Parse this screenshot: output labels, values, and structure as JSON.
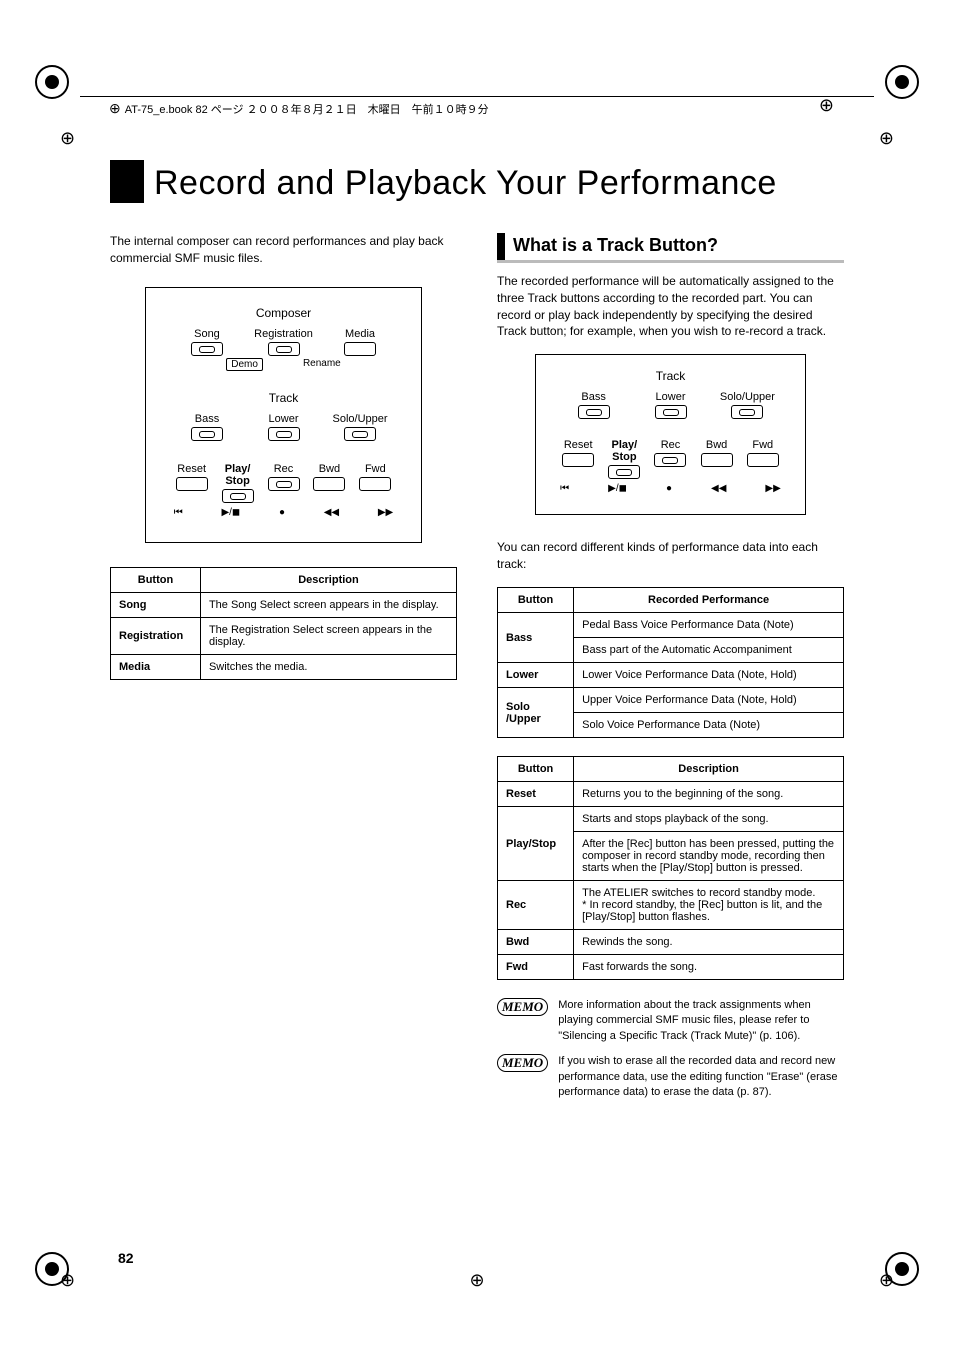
{
  "header_label": "AT-75_e.book 82 ページ ２００８年８月２１日　木曜日　午前１０時９分",
  "page_number": "82",
  "title": "Record and Playback Your Performance",
  "intro": "The internal composer can record performances and play back commercial SMF music files.",
  "composer_panel": {
    "title": "Composer",
    "row1": [
      "Song",
      "Registration",
      "Media"
    ],
    "connectors": [
      "Demo",
      "Rename"
    ],
    "track_title": "Track",
    "row2": [
      "Bass",
      "Lower",
      "Solo/Upper"
    ],
    "row3": [
      "Reset",
      "Play/\nStop",
      "Rec",
      "Bwd",
      "Fwd"
    ],
    "symbols": [
      "⏮",
      "▶/◼",
      "●",
      "◀◀",
      "▶▶"
    ]
  },
  "table1": {
    "headers": [
      "Button",
      "Description"
    ],
    "rows": [
      {
        "k": "Song",
        "v": "The Song Select screen appears in the display."
      },
      {
        "k": "Registration",
        "v": "The Registration Select screen appears in the display."
      },
      {
        "k": "Media",
        "v": "Switches the media."
      }
    ]
  },
  "section_title": "What is a Track Button?",
  "section_intro": "The recorded performance will be automatically assigned to the three Track buttons according to the recorded part. You can record or play back independently by specifying the desired Track button; for example, when you wish to re-record a track.",
  "track_panel": {
    "title": "Track",
    "row1": [
      "Bass",
      "Lower",
      "Solo/Upper"
    ],
    "row2": [
      "Reset",
      "Play/\nStop",
      "Rec",
      "Bwd",
      "Fwd"
    ],
    "symbols": [
      "⏮",
      "▶/◼",
      "●",
      "◀◀",
      "▶▶"
    ]
  },
  "track_note": "You can record different kinds of performance data into each track:",
  "table2": {
    "headers": [
      "Button",
      "Recorded Performance"
    ],
    "rows": [
      {
        "k": "Bass",
        "v": "Pedal Bass Voice Performance Data (Note)",
        "rowspan": 2
      },
      {
        "v2": "Bass part of the Automatic Accompaniment"
      },
      {
        "k": "Lower",
        "v": "Lower Voice Performance Data (Note, Hold)"
      },
      {
        "k": "Solo\n/Upper",
        "v": "Upper Voice Performance Data (Note, Hold)",
        "rowspan": 2
      },
      {
        "v2": "Solo Voice Performance Data (Note)"
      }
    ]
  },
  "table3": {
    "headers": [
      "Button",
      "Description"
    ],
    "rows": [
      {
        "k": "Reset",
        "v": "Returns you to the beginning of the song."
      },
      {
        "k": "Play/Stop",
        "v": "Starts and stops playback of the song.",
        "rowspan": 2
      },
      {
        "v2": "After the [Rec] button has been pressed, putting the composer in record standby mode, recording then starts when the [Play/Stop] button is pressed."
      },
      {
        "k": "Rec",
        "v": "The ATELIER switches to record standby mode.\n*  In record standby, the [Rec] button is lit, and the [Play/Stop] button flashes."
      },
      {
        "k": "Bwd",
        "v": "Rewinds the song."
      },
      {
        "k": "Fwd",
        "v": "Fast forwards the song."
      }
    ]
  },
  "memo1": "More information about the track assignments when playing commercial SMF music files, please refer to \"Silencing a Specific Track (Track Mute)\" (p. 106).",
  "memo2": "If you wish to erase all the recorded data and record new performance data, use the editing function \"Erase\" (erase performance data) to erase the data (p. 87).",
  "memo_label": "MEMO"
}
